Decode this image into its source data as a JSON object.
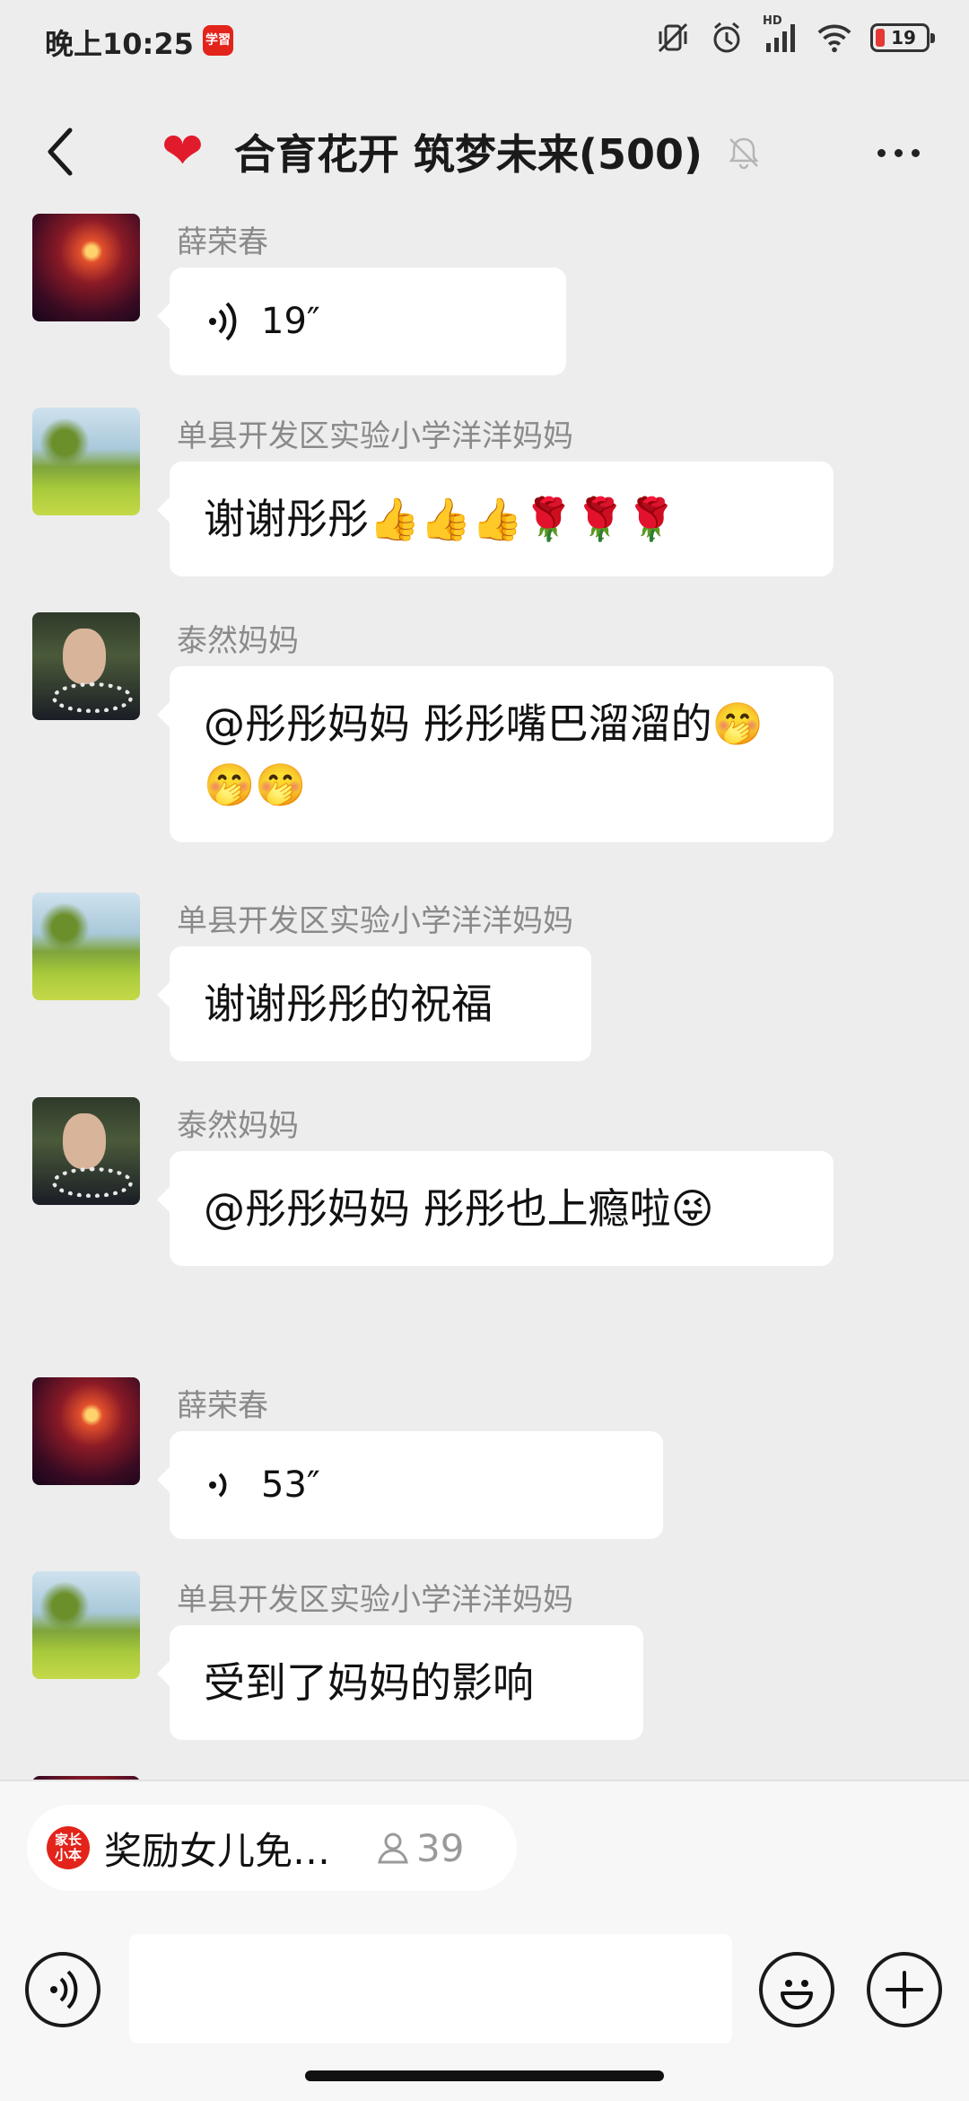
{
  "status_bar": {
    "time": "晚上10:25",
    "app_badge": "学習",
    "hd_label": "HD",
    "battery": "19"
  },
  "header": {
    "heart": "❤",
    "title": "合育花开 筑梦未来(500)"
  },
  "messages": [
    {
      "sender": "薛荣春",
      "avatar": "fireworks",
      "type": "voice",
      "duration": "19″"
    },
    {
      "sender": "单县开发区实验小学洋洋妈妈",
      "avatar": "field",
      "type": "text",
      "text": "谢谢彤彤👍👍👍🌹🌹🌹"
    },
    {
      "sender": "泰然妈妈",
      "avatar": "woman",
      "type": "text",
      "text": "@彤彤妈妈  彤彤嘴巴溜溜的🤭🤭🤭"
    },
    {
      "sender": "单县开发区实验小学洋洋妈妈",
      "avatar": "field",
      "type": "text",
      "text": "谢谢彤彤的祝福"
    },
    {
      "sender": "泰然妈妈",
      "avatar": "woman",
      "type": "text",
      "text": "@彤彤妈妈  彤彤也上瘾啦😜"
    },
    {
      "sender": "薛荣春",
      "avatar": "fireworks",
      "type": "voice",
      "duration": "53″"
    },
    {
      "sender": "单县开发区实验小学洋洋妈妈",
      "avatar": "field",
      "type": "text",
      "text": "受到了妈妈的影响"
    }
  ],
  "bottom": {
    "chip_logo": "家长小本",
    "chip_logo_line1": "家长",
    "chip_logo_line2": "小本",
    "chip_text": "奖励女儿免…",
    "chip_count": "39",
    "input_placeholder": ""
  }
}
